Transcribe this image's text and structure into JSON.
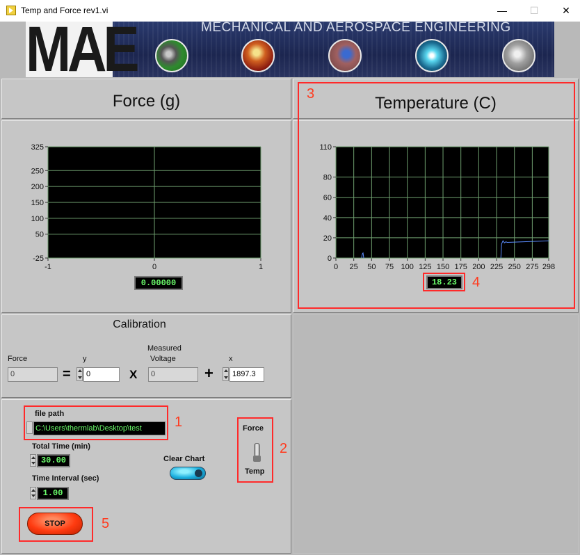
{
  "window": {
    "title": "Temp and Force rev1.vi",
    "minimize": "—",
    "maximize": "☐",
    "close": "✕"
  },
  "banner": {
    "logo_text": "MAE",
    "tagline": "MECHANICAL AND AEROSPACE ENGINEERING"
  },
  "force_panel": {
    "heading": "Force (g)",
    "value": "0.00000"
  },
  "temp_panel": {
    "heading": "Temperature (C)",
    "value": "18.23"
  },
  "calibration": {
    "heading": "Calibration",
    "force_label": "Force",
    "force_value": "0",
    "equals": "=",
    "times": "X",
    "plus": "+",
    "y_label": "y",
    "y_value": "0",
    "measured_label_1": "Measured",
    "measured_label_2": "Voltage",
    "measured_value": "0",
    "x_label": "x",
    "x_value": "1897.3"
  },
  "controls": {
    "file_path_label": "file path",
    "file_path_value": "C:\\Users\\thermlab\\Desktop\\test",
    "total_time_label": "Total Time (min)",
    "total_time_value": "30.00",
    "interval_label": "Time Interval (sec)",
    "interval_value": "1.00",
    "clear_chart_label": "Clear Chart",
    "switch_top_label": "Force",
    "switch_bottom_label": "Temp",
    "stop_label": "STOP"
  },
  "annotations": [
    "1",
    "2",
    "3",
    "4",
    "5"
  ],
  "colors": {
    "chart_bg": "#000000",
    "grid": "#6f9f6f",
    "trace": "#5b8cff",
    "readout": "#6cff6c",
    "stop": "#ff3b10",
    "annotation": "#ff2a2a"
  },
  "chart_data": [
    {
      "type": "line",
      "title": "Force (g)",
      "xlim": [
        -1,
        1
      ],
      "ylim": [
        -25,
        325
      ],
      "x_ticks": [
        "-1",
        "0",
        "1"
      ],
      "y_ticks": [
        "325",
        "250",
        "200",
        "150",
        "100",
        "50",
        "-25"
      ],
      "series": []
    },
    {
      "type": "line",
      "title": "Temperature (C)",
      "xlim": [
        0,
        298
      ],
      "ylim": [
        0,
        110
      ],
      "x_ticks": [
        "0",
        "25",
        "50",
        "75",
        "100",
        "125",
        "150",
        "175",
        "200",
        "225",
        "250",
        "275",
        "298"
      ],
      "y_ticks": [
        "110",
        "80",
        "60",
        "40",
        "20",
        "0"
      ],
      "series": [
        {
          "x": [
            36,
            37,
            38,
            39
          ],
          "y": [
            0,
            4,
            5,
            0
          ]
        },
        {
          "x": [
            231,
            232,
            234,
            236,
            238,
            240,
            260,
            280,
            298
          ],
          "y": [
            0,
            14,
            17,
            15,
            16,
            15.5,
            16,
            16.5,
            17
          ]
        }
      ]
    }
  ]
}
